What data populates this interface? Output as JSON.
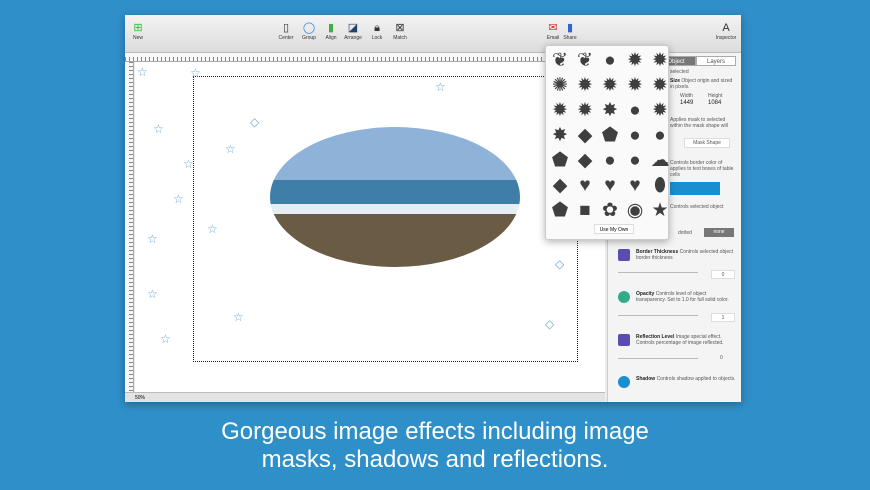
{
  "toolbar": {
    "new": "New",
    "center": "Center",
    "group": "Group",
    "align": "Align",
    "arrange": "Arrange",
    "lock": "Lock",
    "match": "Match",
    "email": "Email",
    "share": "Share",
    "inspector": "Inspector"
  },
  "zoom": "50%",
  "inspector": {
    "tabs": [
      "Object",
      "Layers"
    ],
    "selected": "selected",
    "size_title": "Size",
    "size_desc": "Object origin and sized in pixels.",
    "width_label": "Width",
    "width": "1449",
    "height_label": "Height",
    "height": "1084",
    "mask_desc": "Applies mask to selected within the mask shape will",
    "mask_button": "Mask Shape",
    "border_desc": "Controls border color of applies to text boxes of table cells",
    "style_desc": "Controls selected object",
    "border_style": "dotted",
    "border_none": "none",
    "border_thickness": {
      "title": "Border Thickness",
      "desc": "Controls selected object border thickness",
      "value": "0"
    },
    "opacity": {
      "title": "Opacity",
      "desc": "Controls level of object transparency. Set to 1.0 for full solid color.",
      "value": "1"
    },
    "reflection": {
      "title": "Reflection Level",
      "desc": "Image special effect. Controls percentage of image reflected.",
      "value": "0"
    },
    "shadow": {
      "title": "Shadow",
      "desc": "Controls shadow applied to objects."
    }
  },
  "shapes": {
    "glyphs": [
      "❦",
      "❦",
      "●",
      "✹",
      "✹",
      "✺",
      "✹",
      "✹",
      "✹",
      "✹",
      "✹",
      "✹",
      "✸",
      "●",
      "✹",
      "✸",
      "◆",
      "⬟",
      "●",
      "●",
      "⬟",
      "◆",
      "●",
      "●",
      "☁",
      "◆",
      "♥",
      "♥",
      "♥",
      "⬮",
      "⬟",
      "■",
      "✿",
      "◉",
      "★",
      "★",
      "✺",
      "▶",
      "◔",
      "💧"
    ],
    "use_own": "Use My Own"
  },
  "caption": [
    "Gorgeous image effects including image",
    "masks, shadows and reflections."
  ],
  "colors": {
    "background": "#2f8fc8",
    "border_color": "#1a8fd0"
  }
}
